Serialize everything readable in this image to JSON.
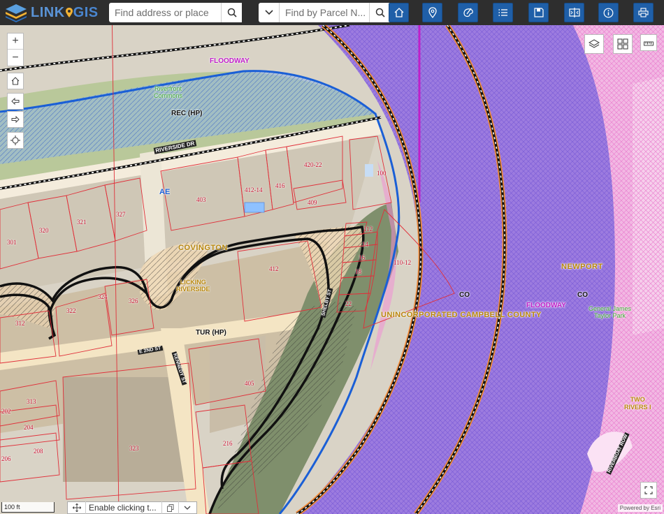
{
  "app": {
    "logo": {
      "left": "LINK",
      "right": "GIS"
    },
    "search_address": {
      "placeholder": "Find address or place"
    },
    "search_parcel": {
      "placeholder": "Find by Parcel N..."
    }
  },
  "toolbar": [
    {
      "name": "home-tool-button",
      "icon": "home-icon"
    },
    {
      "name": "location-tool-button",
      "icon": "map-pin-icon"
    },
    {
      "name": "basemap-tool-button",
      "icon": "palette-icon"
    },
    {
      "name": "layer-list-tool-button",
      "icon": "list-icon"
    },
    {
      "name": "save-tool-button",
      "icon": "save-icon"
    },
    {
      "name": "compare-tool-button",
      "icon": "swipe-icon"
    },
    {
      "name": "info-tool-button",
      "icon": "info-icon"
    },
    {
      "name": "print-tool-button",
      "icon": "print-icon"
    }
  ],
  "map_labels": {
    "floodway_top": "FLOODWAY",
    "riverfront_commons": "Riverfront\nCommons",
    "rec_hp": "REC (HP)",
    "riverside_dr": "RIVERSIDE DR",
    "ae": "AE",
    "covington": "COVINGTON",
    "licking_riverside": "LICKING\nRIVERSIDE",
    "tur_hp": "TUR (HP)",
    "kennedy_st": "KENNEDY ST",
    "e_2nd_st": "E 2ND ST",
    "shelby_st": "SHELBY ST",
    "co_1": "CO",
    "co_2": "CO",
    "newport": "NEWPORT",
    "floodway_right": "FLOODWAY",
    "unincorporated": "UNINCORPORATED CAMPBELL COUNTY",
    "general_james": "General James\nTaylor Park",
    "two_rivers": "TWO\nRIVERS I",
    "riverboat_row": "RIVERBOAT ROW"
  },
  "parcels": [
    "301",
    "320",
    "321",
    "327",
    "403",
    "412-14",
    "416",
    "420-22",
    "409",
    "100",
    "412",
    "112",
    "14",
    "16",
    "18",
    "22",
    "110-12",
    "324",
    "326",
    "322",
    "312",
    "405",
    "313",
    "202",
    "204",
    "208",
    "206",
    "323",
    "216"
  ],
  "widgets": {
    "zoom_in": "+",
    "zoom_out": "−",
    "scale": "100 ft",
    "click_toggle": "Enable clicking t...",
    "attribution": "Powered by Esri"
  },
  "colors": {
    "topbar": "#2e2e2e",
    "tool_blue": "#1f5fa8",
    "floodway": "#8a63e6",
    "flood_pink": "#ef8fd6",
    "parcel_line": "#e0303a",
    "label_gold": "#b8860b",
    "park_green": "#3ea832",
    "zone_blue_line": "#1a5fd6"
  }
}
